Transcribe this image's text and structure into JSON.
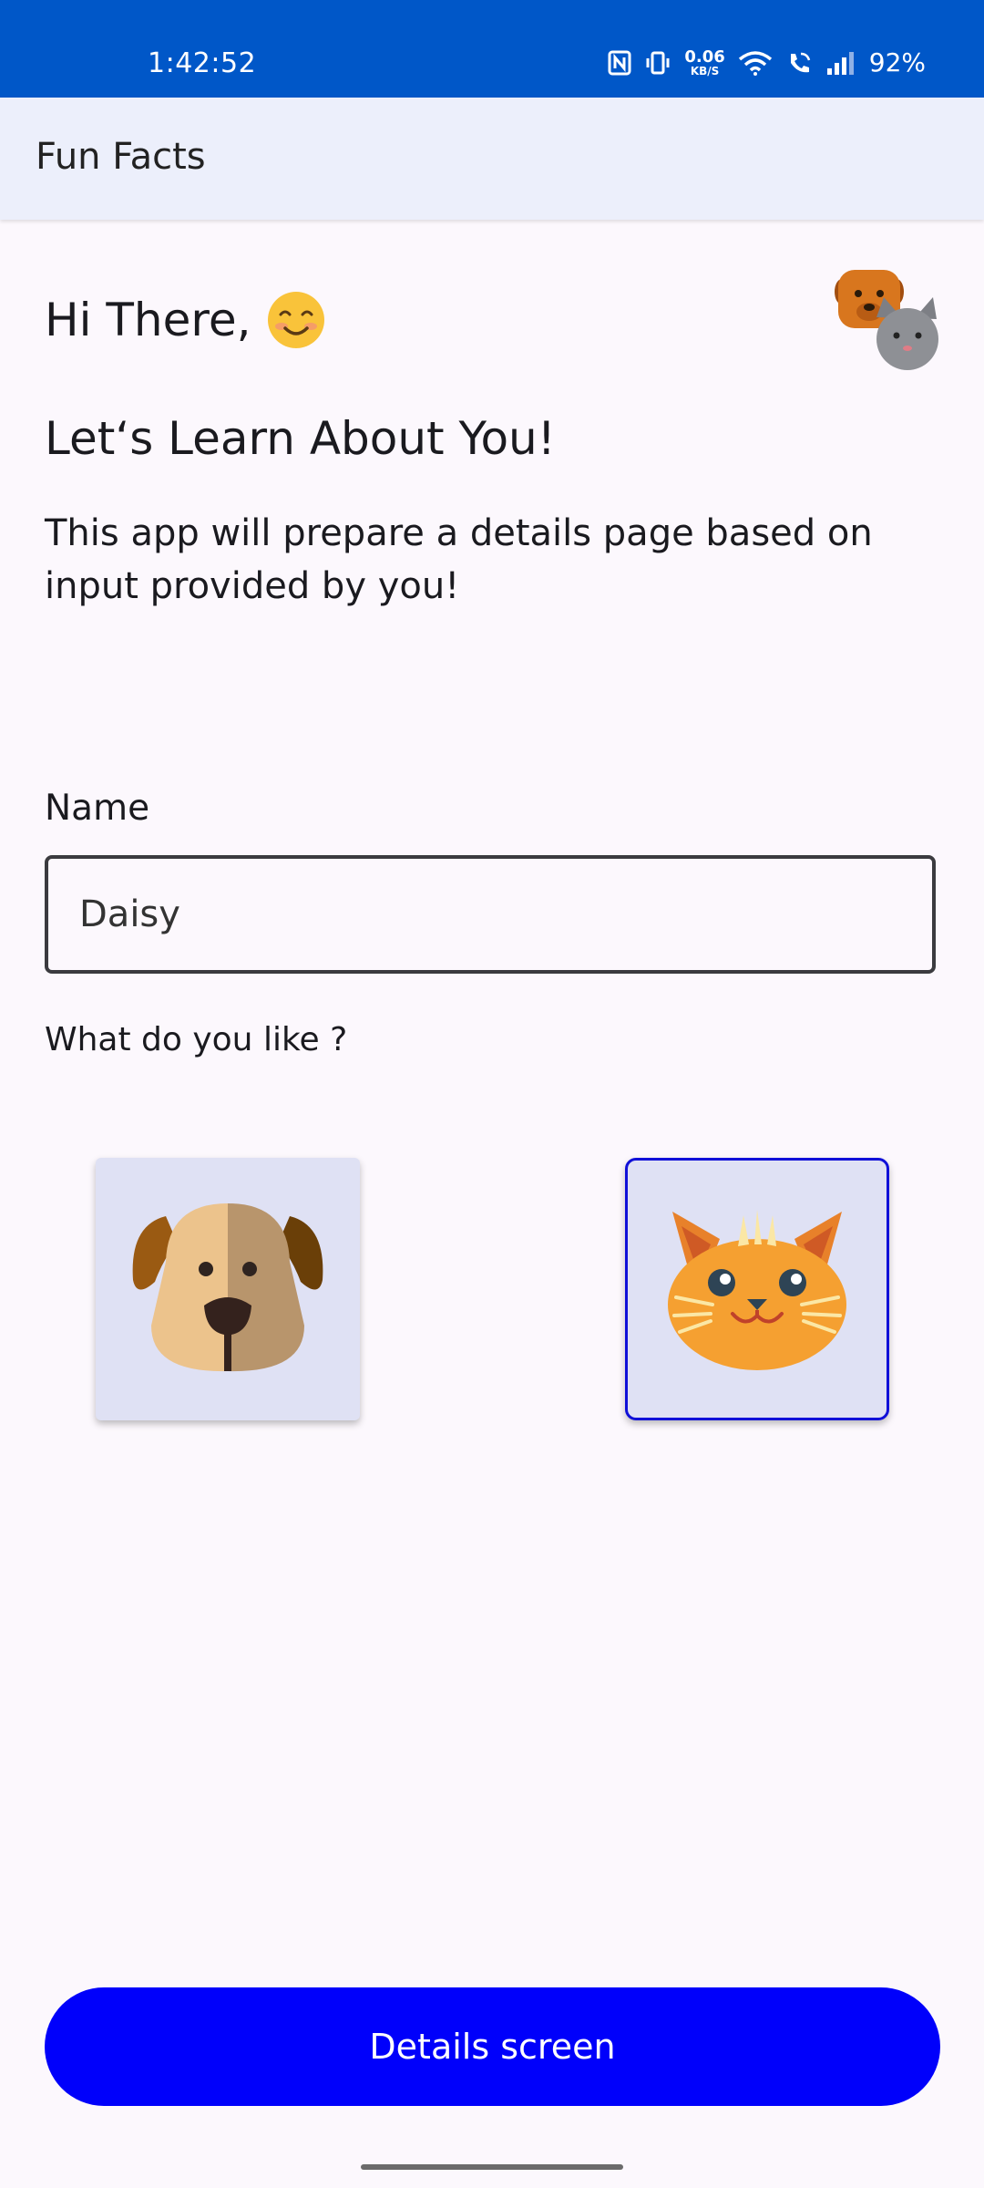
{
  "status_bar": {
    "time": "1:42:52",
    "net_speed_value": "0.06",
    "net_speed_unit": "KB/S",
    "battery": "92%"
  },
  "app_bar": {
    "title": "Fun Facts"
  },
  "main": {
    "greeting": "Hi There,",
    "greeting_emoji": "smiley-face-icon",
    "subtitle": "Let‘s Learn About You!",
    "intro": "This app will prepare a details page based on input provided by you!",
    "name_label": "Name",
    "name_value": "Daisy",
    "like_label": "What do you like ?",
    "options": [
      {
        "icon": "dog-face-icon",
        "selected": false
      },
      {
        "icon": "cat-face-icon",
        "selected": true
      }
    ]
  },
  "button": {
    "label": "Details screen"
  },
  "colors": {
    "status_bar": "#0057c8",
    "app_bar": "#eceffb",
    "button": "#0000fb",
    "selected_border": "#1010d8",
    "card_bg": "#dfe1f4"
  }
}
